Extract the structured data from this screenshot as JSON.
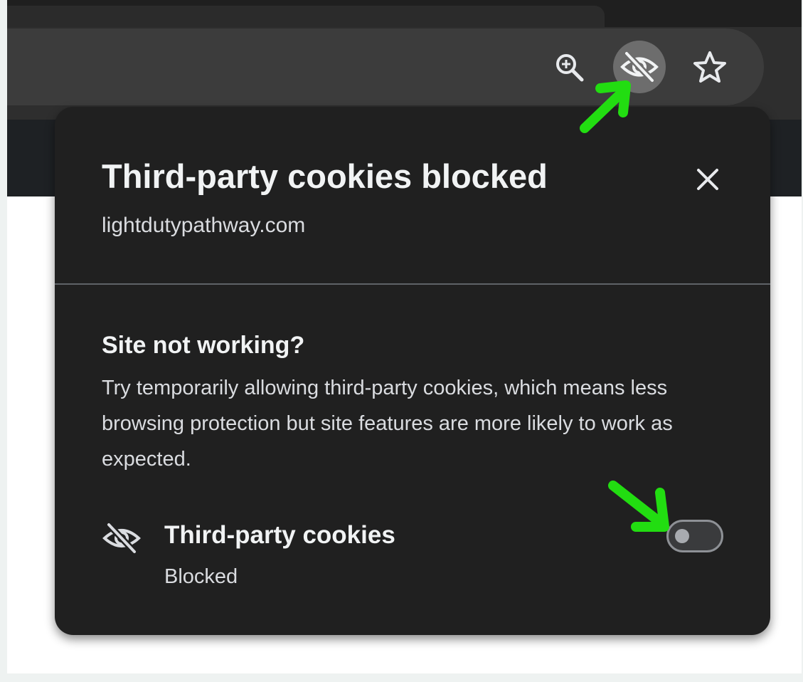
{
  "toolbar": {
    "icons": [
      "zoom-in-icon",
      "third-party-cookies-blocked-icon",
      "bookmark-star-icon"
    ]
  },
  "popup": {
    "title": "Third-party cookies blocked",
    "domain": "lightdutypathway.com",
    "close_icon": "close-icon",
    "section": {
      "heading": "Site not working?",
      "body": "Try temporarily allowing third-party cookies, which means less browsing protection but site features are more likely to work as expected."
    },
    "cookie_row": {
      "icon": "eye-off-icon",
      "label": "Third-party cookies",
      "status": "Blocked",
      "toggle_on": false
    }
  },
  "colors": {
    "popup_bg": "#202020",
    "annotation_arrow": "#22dd11",
    "toolbar_bg": "#2e2e2e",
    "omnibox_bg": "#3c3c3c"
  }
}
